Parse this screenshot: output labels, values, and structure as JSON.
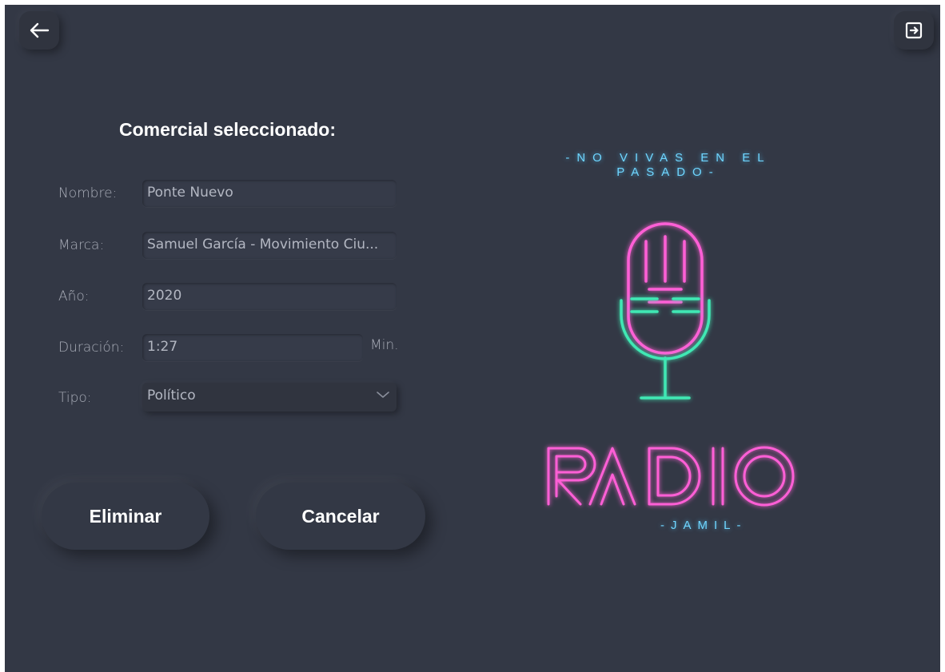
{
  "toolbar": {
    "back_icon": "arrow-left-icon",
    "exit_icon": "logout-icon"
  },
  "form": {
    "title": "Comercial seleccionado:",
    "fields": {
      "nombre": {
        "label": "Nombre:",
        "value": "Ponte Nuevo"
      },
      "marca": {
        "label": "Marca:",
        "value": "Samuel García - Movimiento Ciu..."
      },
      "anio": {
        "label": "Año:",
        "value": "2020"
      },
      "duracion": {
        "label": "Duración:",
        "value": "1:27",
        "unit": "Min."
      },
      "tipo": {
        "label": "Tipo:",
        "value": "Político"
      }
    }
  },
  "actions": {
    "delete_label": "Eliminar",
    "cancel_label": "Cancelar"
  },
  "branding": {
    "slogan_line1": "-NO VIVAS EN EL",
    "slogan_line2": "PASADO-",
    "logo_text": "RADIO",
    "subtitle": "-JAMIL-",
    "colors": {
      "neon_pink": "#ff5fd6",
      "neon_green": "#3fe8b4",
      "neon_blue": "#6fd6ff",
      "background": "#333845"
    }
  }
}
